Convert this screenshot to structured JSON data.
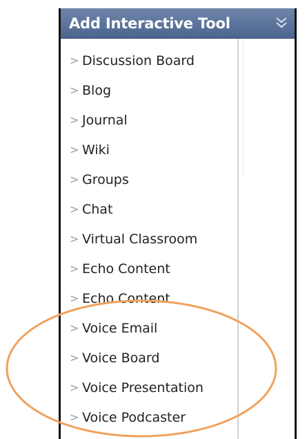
{
  "header": {
    "title": "Add Interactive Tool",
    "chevron_icon": "double-chevron-down-icon"
  },
  "menu": {
    "items": [
      {
        "label": "Discussion Board"
      },
      {
        "label": "Blog"
      },
      {
        "label": "Journal"
      },
      {
        "label": "Wiki"
      },
      {
        "label": "Groups"
      },
      {
        "label": "Chat"
      },
      {
        "label": "Virtual Classroom"
      },
      {
        "label": "Echo Content"
      },
      {
        "label": "Echo Content"
      },
      {
        "label": "Voice Email"
      },
      {
        "label": "Voice Board"
      },
      {
        "label": "Voice Presentation"
      },
      {
        "label": "Voice Podcaster"
      }
    ],
    "arrow_glyph": ">"
  },
  "colors": {
    "header_bg": "#5b7299",
    "annotation": "#f0a15c"
  }
}
